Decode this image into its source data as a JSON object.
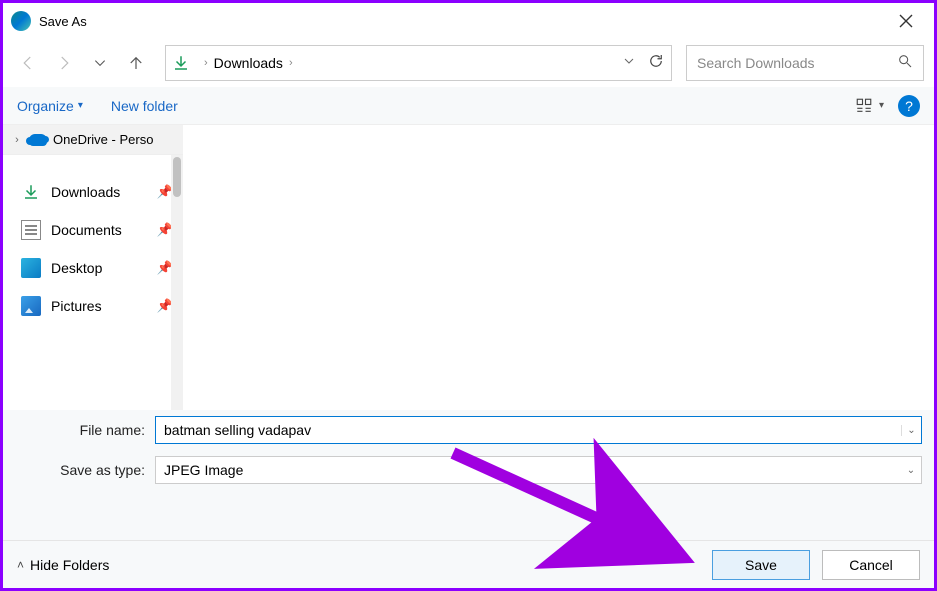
{
  "titlebar": {
    "title": "Save As"
  },
  "nav": {
    "location": "Downloads"
  },
  "search": {
    "placeholder": "Search Downloads"
  },
  "toolbar": {
    "organize": "Organize",
    "newfolder": "New folder"
  },
  "sidebar": {
    "onedrive": "OneDrive - Perso",
    "items": [
      {
        "label": "Downloads"
      },
      {
        "label": "Documents"
      },
      {
        "label": "Desktop"
      },
      {
        "label": "Pictures"
      }
    ]
  },
  "form": {
    "filename_label": "File name:",
    "filename_value": "batman selling vadapav",
    "type_label": "Save as type:",
    "type_value": "JPEG Image"
  },
  "footer": {
    "hide": "Hide Folders",
    "save": "Save",
    "cancel": "Cancel"
  }
}
